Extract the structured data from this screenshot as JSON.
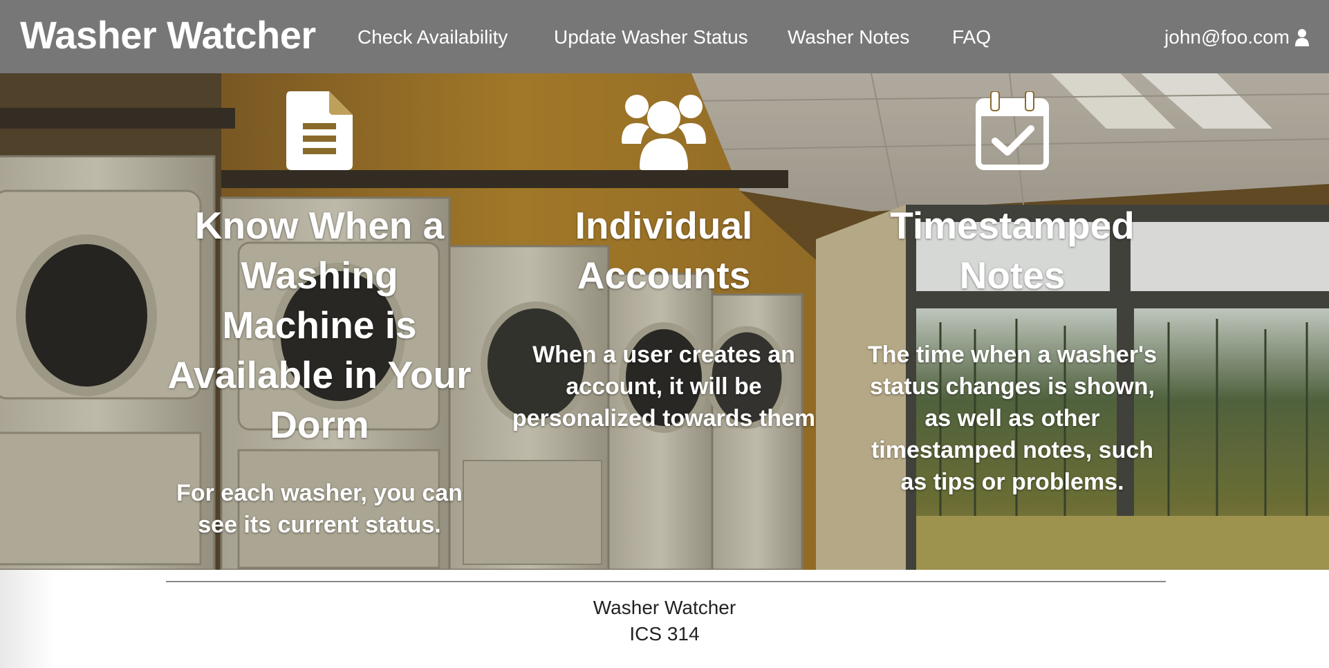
{
  "navbar": {
    "brand": "Washer Watcher",
    "links": [
      {
        "label": "Check Availability"
      },
      {
        "label": "Update Washer Status"
      },
      {
        "label": "Washer Notes"
      },
      {
        "label": "FAQ"
      }
    ],
    "user": {
      "email": "john@foo.com",
      "icon": "user-icon"
    }
  },
  "features": [
    {
      "icon": "document-icon",
      "title": "Know When a Washing Machine is Available in Your Dorm",
      "text": "For each washer, you can see its current status."
    },
    {
      "icon": "users-icon",
      "title": "Individual Accounts",
      "text": "When a user creates an account, it will be personalized towards them"
    },
    {
      "icon": "calendar-check-icon",
      "title": "Timestamped Notes",
      "text": "The time when a washer's status changes is shown, as well as other timestamped notes, such as tips or problems."
    }
  ],
  "footer": {
    "line1": "Washer Watcher",
    "line2": "ICS 314"
  },
  "colors": {
    "navbar_bg": "#777777",
    "text_light": "#ffffff",
    "footer_text": "#222222"
  }
}
